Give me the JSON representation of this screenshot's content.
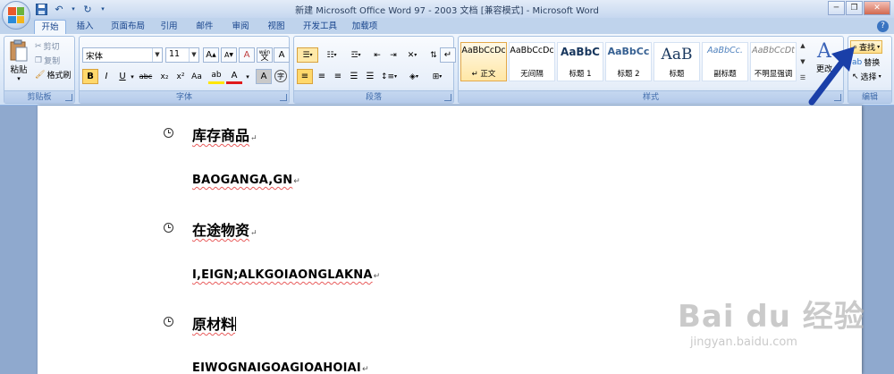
{
  "window": {
    "title": "新建 Microsoft Office Word 97 - 2003 文档 [兼容模式] - Microsoft Word",
    "controls": {
      "minimize": "─",
      "restore": "❐",
      "close": "✕"
    }
  },
  "tabs": [
    "开始",
    "插入",
    "页面布局",
    "引用",
    "邮件",
    "审阅",
    "视图",
    "开发工具",
    "加载项"
  ],
  "clipboard": {
    "label": "剪贴板",
    "paste": "粘贴",
    "cut": "剪切",
    "copy": "复制",
    "format_painter": "格式刷"
  },
  "font": {
    "label": "字体",
    "name": "宋体",
    "size": "11",
    "grow": "A",
    "shrink": "A",
    "clear": "A",
    "wen": "wén",
    "wen_char": "文",
    "border": "A",
    "bold": "B",
    "italic": "I",
    "underline": "U",
    "strike": "abc",
    "sub": "x₂",
    "sup": "x²",
    "case": "Aa",
    "highlight": "ab",
    "color": "A",
    "char_shade": "A",
    "enclose": "字"
  },
  "paragraph": {
    "label": "段落"
  },
  "styles": {
    "label": "样式",
    "items": [
      {
        "sample": "AaBbCcDc",
        "name": "↵ 正文"
      },
      {
        "sample": "AaBbCcDc",
        "name": "无间隔"
      },
      {
        "sample": "AaBbC",
        "name": "标题 1"
      },
      {
        "sample": "AaBbCc",
        "name": "标题 2"
      },
      {
        "sample": "AaB",
        "name": "标题"
      },
      {
        "sample": "AaBbCc.",
        "name": "副标题"
      },
      {
        "sample": "AaBbCcDt",
        "name": "不明显强调"
      }
    ],
    "change_styles": "更改",
    "change_glyph": "A"
  },
  "editing": {
    "label": "编辑",
    "find": "查找",
    "replace": "替换",
    "select": "选择"
  },
  "document": {
    "lines": [
      {
        "text": "库存商品",
        "type": "cn",
        "bullet": true
      },
      {
        "text": "BAOGANGA,GN",
        "type": "en",
        "bullet": false
      },
      {
        "text": "在途物资",
        "type": "cn",
        "bullet": true
      },
      {
        "text": "I,EIGN;ALKGOIAONGLAKNA",
        "type": "en",
        "bullet": false
      },
      {
        "text": "原材料",
        "type": "cn",
        "bullet": true
      },
      {
        "text": "EIWOGNAIGOAGIOAHOIAI",
        "type": "en",
        "bullet": false
      }
    ],
    "pilcrow": "↵"
  },
  "watermark": {
    "main": "Bai du 经验",
    "sub": "jingyan.baidu.com"
  },
  "colors": {
    "arrow": "#1a3fa8",
    "accent": "#15428b",
    "page": "#ffffff"
  }
}
